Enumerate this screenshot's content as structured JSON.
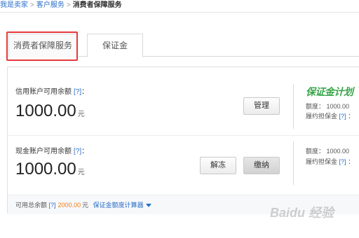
{
  "breadcrumb": {
    "items": [
      "我是卖家",
      "客户服务"
    ],
    "current": "消费者保障服务",
    "sep": ">"
  },
  "tabs": [
    {
      "label": "消费者保障服务",
      "selected": false
    },
    {
      "label": "保证金",
      "selected": true
    }
  ],
  "credit": {
    "label": "信用账户可用余额",
    "help": "[?]",
    "colon": "：",
    "amount": "1000.00",
    "unit": "元",
    "manage_label": "管理"
  },
  "side1": {
    "logo": "保证金计划",
    "quota_label": "额度：",
    "quota_value": "1000.00",
    "deposit_label": "履约担保金",
    "help": "[?]",
    "colon": "："
  },
  "cash": {
    "label": "现金账户可用余额",
    "help": "[?]",
    "colon": "：",
    "amount": "1000.00",
    "unit": "元",
    "unfreeze_label": "解冻",
    "pay_label": "缴纳"
  },
  "side2": {
    "quota_label": "额度：",
    "quota_value": "1000.00",
    "deposit_label": "履约担保金",
    "help": "[?]",
    "colon": "："
  },
  "footer": {
    "label": "可用总余额",
    "help": "[?]",
    "total": "2000.00",
    "unit": "元",
    "calc_label": "保证金额度计算器"
  },
  "watermark": "Baidu 经验",
  "colors": {
    "accent": "#2a6fc9",
    "highlight": "#e53a3a",
    "total": "#f07e16",
    "logo": "#3aa54a"
  }
}
